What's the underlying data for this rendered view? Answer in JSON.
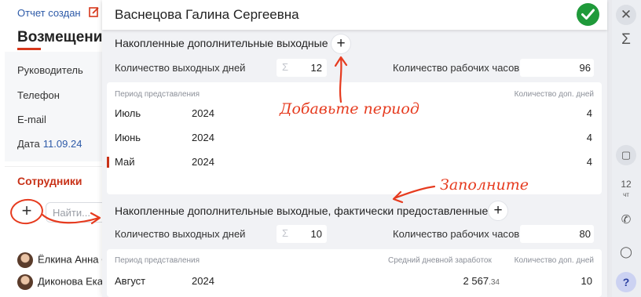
{
  "background": {
    "status": "Отчет создан",
    "heading": "Возмещение",
    "info": [
      {
        "label": "Руководитель",
        "value": ""
      },
      {
        "label": "Телефон",
        "value": ""
      },
      {
        "label": "E-mail",
        "value": ""
      },
      {
        "label": "Дата",
        "value": "11.09.24"
      }
    ],
    "employees_title": "Сотрудники",
    "add_symbol": "+",
    "search_placeholder": "Найти...",
    "people": [
      "Ёлкина Анна С",
      "Диконова Екат"
    ]
  },
  "rail": {
    "close": "✕",
    "sum": "Σ",
    "note": "▢",
    "calendar_day": "12",
    "calendar_weekday": "чт",
    "phone": "✆",
    "chat": "◯",
    "help": "?"
  },
  "dialog": {
    "title": "Васнецова Галина Сергеевна",
    "accent_color": "#1f9a3a",
    "section1": {
      "title": "Накопленные дополнительные выходные",
      "add": "+",
      "days_label": "Количество выходных дней",
      "days_value": "12",
      "hours_label": "Количество рабочих часов",
      "hours_value": "96",
      "columns": [
        "Период представления",
        "Количество доп. дней"
      ],
      "rows": [
        {
          "month": "Июль",
          "year": "2024",
          "days": "4"
        },
        {
          "month": "Июнь",
          "year": "2024",
          "days": "4"
        },
        {
          "month": "Май",
          "year": "2024",
          "days": "4"
        }
      ]
    },
    "section2": {
      "title": "Накопленные дополнительные выходные, фактически предоставленные",
      "add": "+",
      "days_label": "Количество выходных дней",
      "days_value": "10",
      "hours_label": "Количество рабочих часов",
      "hours_value": "80",
      "columns": [
        "Период представления",
        "Средний дневной заработок",
        "Количество доп. дней"
      ],
      "rows": [
        {
          "month": "Август",
          "year": "2024",
          "earnings_int": "2 567",
          "earnings_frac": ".34",
          "days": "10"
        }
      ]
    }
  },
  "annotations": {
    "add_period": "Добавьте период",
    "fill_in": "Заполните",
    "color": "#e63b1f"
  },
  "sigma": "Σ"
}
